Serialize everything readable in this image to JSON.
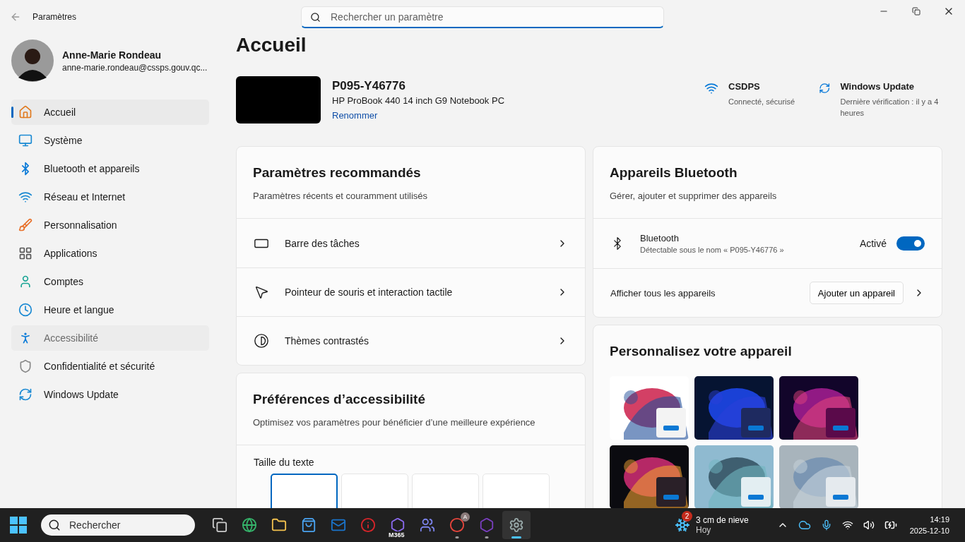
{
  "window": {
    "title": "Paramètres",
    "search_placeholder": "Rechercher un paramètre"
  },
  "profile": {
    "name": "Anne-Marie Rondeau",
    "email": "anne-marie.rondeau@cssps.gouv.qc..."
  },
  "sidebar": {
    "items": [
      {
        "label": "Accueil",
        "selected": true,
        "hovered": false
      },
      {
        "label": "Système",
        "selected": false,
        "hovered": false
      },
      {
        "label": "Bluetooth et appareils",
        "selected": false,
        "hovered": false
      },
      {
        "label": "Réseau et Internet",
        "selected": false,
        "hovered": false
      },
      {
        "label": "Personnalisation",
        "selected": false,
        "hovered": false
      },
      {
        "label": "Applications",
        "selected": false,
        "hovered": false
      },
      {
        "label": "Comptes",
        "selected": false,
        "hovered": false
      },
      {
        "label": "Heure et langue",
        "selected": false,
        "hovered": false
      },
      {
        "label": "Accessibilité",
        "selected": false,
        "hovered": true
      },
      {
        "label": "Confidentialité et sécurité",
        "selected": false,
        "hovered": false
      },
      {
        "label": "Windows Update",
        "selected": false,
        "hovered": false
      }
    ]
  },
  "page_title": "Accueil",
  "device": {
    "name": "P095-Y46776",
    "model": "HP ProBook 440 14 inch G9 Notebook PC",
    "rename_link": "Renommer"
  },
  "status": [
    {
      "kind": "wifi",
      "title": "CSDPS",
      "detail": "Connecté, sécurisé"
    },
    {
      "kind": "update",
      "title": "Windows Update",
      "detail": "Dernière vérification : il y a 4 heures"
    }
  ],
  "recommended": {
    "title": "Paramètres recommandés",
    "subtitle": "Paramètres récents et couramment utilisés",
    "rows": [
      {
        "kind": "taskbar",
        "label": "Barre des tâches"
      },
      {
        "kind": "pointer",
        "label": "Pointeur de souris et interaction tactile"
      },
      {
        "kind": "contrast",
        "label": "Thèmes contrastés"
      }
    ]
  },
  "accessibility": {
    "title": "Préférences d’accessibilité",
    "subtitle": "Optimisez vos paramètres pour bénéficier d’une meilleure expérience",
    "text_size_label": "Taille du texte",
    "text_size_options": [
      {
        "selected": true
      },
      {
        "selected": false
      },
      {
        "selected": false
      },
      {
        "selected": false
      }
    ]
  },
  "bluetooth": {
    "title": "Appareils Bluetooth",
    "subtitle": "Gérer, ajouter et supprimer des appareils",
    "device": {
      "name": "Bluetooth",
      "detail": "Détectable sous le nom « P095-Y46776 »",
      "state_label": "Activé",
      "on": true
    },
    "show_all": "Afficher tous les appareils",
    "add_button": "Ajouter un appareil"
  },
  "personalize": {
    "title": "Personnalisez votre appareil"
  },
  "taskbar": {
    "search_placeholder": "Rechercher",
    "apps": [
      {
        "kind": "taskview",
        "running": false,
        "active": false
      },
      {
        "kind": "edge",
        "running": false,
        "active": false
      },
      {
        "kind": "folder",
        "running": false,
        "active": false
      },
      {
        "kind": "store",
        "running": false,
        "active": false
      },
      {
        "kind": "mail",
        "running": false,
        "active": false
      },
      {
        "kind": "info",
        "running": false,
        "active": false
      },
      {
        "kind": "m365",
        "label": "M365",
        "running": false,
        "active": false
      },
      {
        "kind": "teams",
        "running": false,
        "active": false
      },
      {
        "kind": "chrome",
        "badge": "A",
        "running": true,
        "active": false
      },
      {
        "kind": "purple",
        "running": true,
        "active": false
      },
      {
        "kind": "settings",
        "running": true,
        "active": true
      }
    ],
    "weather": {
      "badge": "2",
      "title": "3 cm de nieve",
      "detail": "Hoy"
    },
    "clock": {
      "time": "14:19",
      "date": "2025-12-10"
    }
  }
}
